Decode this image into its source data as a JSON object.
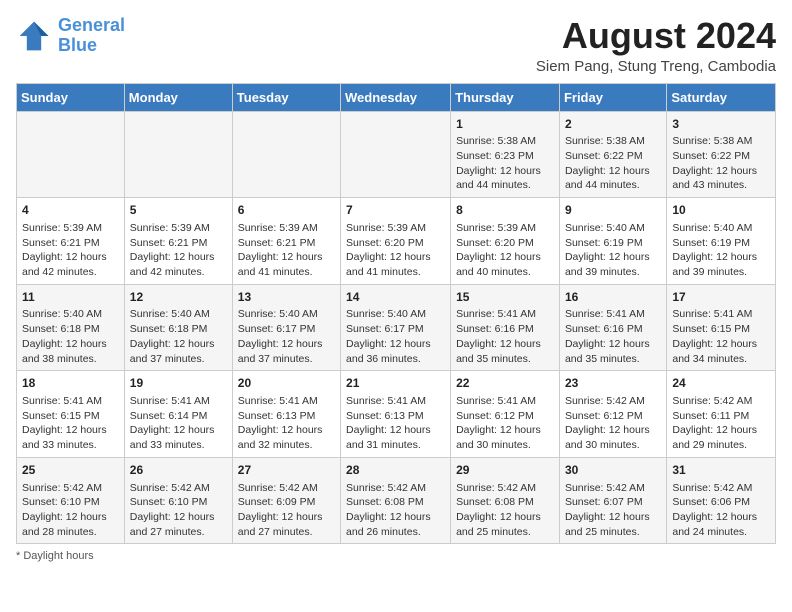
{
  "header": {
    "logo_line1": "General",
    "logo_line2": "Blue",
    "title": "August 2024",
    "subtitle": "Siem Pang, Stung Treng, Cambodia"
  },
  "days_of_week": [
    "Sunday",
    "Monday",
    "Tuesday",
    "Wednesday",
    "Thursday",
    "Friday",
    "Saturday"
  ],
  "weeks": [
    [
      {
        "day": "",
        "info": ""
      },
      {
        "day": "",
        "info": ""
      },
      {
        "day": "",
        "info": ""
      },
      {
        "day": "",
        "info": ""
      },
      {
        "day": "1",
        "info": "Sunrise: 5:38 AM\nSunset: 6:23 PM\nDaylight: 12 hours\nand 44 minutes."
      },
      {
        "day": "2",
        "info": "Sunrise: 5:38 AM\nSunset: 6:22 PM\nDaylight: 12 hours\nand 44 minutes."
      },
      {
        "day": "3",
        "info": "Sunrise: 5:38 AM\nSunset: 6:22 PM\nDaylight: 12 hours\nand 43 minutes."
      }
    ],
    [
      {
        "day": "4",
        "info": "Sunrise: 5:39 AM\nSunset: 6:21 PM\nDaylight: 12 hours\nand 42 minutes."
      },
      {
        "day": "5",
        "info": "Sunrise: 5:39 AM\nSunset: 6:21 PM\nDaylight: 12 hours\nand 42 minutes."
      },
      {
        "day": "6",
        "info": "Sunrise: 5:39 AM\nSunset: 6:21 PM\nDaylight: 12 hours\nand 41 minutes."
      },
      {
        "day": "7",
        "info": "Sunrise: 5:39 AM\nSunset: 6:20 PM\nDaylight: 12 hours\nand 41 minutes."
      },
      {
        "day": "8",
        "info": "Sunrise: 5:39 AM\nSunset: 6:20 PM\nDaylight: 12 hours\nand 40 minutes."
      },
      {
        "day": "9",
        "info": "Sunrise: 5:40 AM\nSunset: 6:19 PM\nDaylight: 12 hours\nand 39 minutes."
      },
      {
        "day": "10",
        "info": "Sunrise: 5:40 AM\nSunset: 6:19 PM\nDaylight: 12 hours\nand 39 minutes."
      }
    ],
    [
      {
        "day": "11",
        "info": "Sunrise: 5:40 AM\nSunset: 6:18 PM\nDaylight: 12 hours\nand 38 minutes."
      },
      {
        "day": "12",
        "info": "Sunrise: 5:40 AM\nSunset: 6:18 PM\nDaylight: 12 hours\nand 37 minutes."
      },
      {
        "day": "13",
        "info": "Sunrise: 5:40 AM\nSunset: 6:17 PM\nDaylight: 12 hours\nand 37 minutes."
      },
      {
        "day": "14",
        "info": "Sunrise: 5:40 AM\nSunset: 6:17 PM\nDaylight: 12 hours\nand 36 minutes."
      },
      {
        "day": "15",
        "info": "Sunrise: 5:41 AM\nSunset: 6:16 PM\nDaylight: 12 hours\nand 35 minutes."
      },
      {
        "day": "16",
        "info": "Sunrise: 5:41 AM\nSunset: 6:16 PM\nDaylight: 12 hours\nand 35 minutes."
      },
      {
        "day": "17",
        "info": "Sunrise: 5:41 AM\nSunset: 6:15 PM\nDaylight: 12 hours\nand 34 minutes."
      }
    ],
    [
      {
        "day": "18",
        "info": "Sunrise: 5:41 AM\nSunset: 6:15 PM\nDaylight: 12 hours\nand 33 minutes."
      },
      {
        "day": "19",
        "info": "Sunrise: 5:41 AM\nSunset: 6:14 PM\nDaylight: 12 hours\nand 33 minutes."
      },
      {
        "day": "20",
        "info": "Sunrise: 5:41 AM\nSunset: 6:13 PM\nDaylight: 12 hours\nand 32 minutes."
      },
      {
        "day": "21",
        "info": "Sunrise: 5:41 AM\nSunset: 6:13 PM\nDaylight: 12 hours\nand 31 minutes."
      },
      {
        "day": "22",
        "info": "Sunrise: 5:41 AM\nSunset: 6:12 PM\nDaylight: 12 hours\nand 30 minutes."
      },
      {
        "day": "23",
        "info": "Sunrise: 5:42 AM\nSunset: 6:12 PM\nDaylight: 12 hours\nand 30 minutes."
      },
      {
        "day": "24",
        "info": "Sunrise: 5:42 AM\nSunset: 6:11 PM\nDaylight: 12 hours\nand 29 minutes."
      }
    ],
    [
      {
        "day": "25",
        "info": "Sunrise: 5:42 AM\nSunset: 6:10 PM\nDaylight: 12 hours\nand 28 minutes."
      },
      {
        "day": "26",
        "info": "Sunrise: 5:42 AM\nSunset: 6:10 PM\nDaylight: 12 hours\nand 27 minutes."
      },
      {
        "day": "27",
        "info": "Sunrise: 5:42 AM\nSunset: 6:09 PM\nDaylight: 12 hours\nand 27 minutes."
      },
      {
        "day": "28",
        "info": "Sunrise: 5:42 AM\nSunset: 6:08 PM\nDaylight: 12 hours\nand 26 minutes."
      },
      {
        "day": "29",
        "info": "Sunrise: 5:42 AM\nSunset: 6:08 PM\nDaylight: 12 hours\nand 25 minutes."
      },
      {
        "day": "30",
        "info": "Sunrise: 5:42 AM\nSunset: 6:07 PM\nDaylight: 12 hours\nand 25 minutes."
      },
      {
        "day": "31",
        "info": "Sunrise: 5:42 AM\nSunset: 6:06 PM\nDaylight: 12 hours\nand 24 minutes."
      }
    ]
  ],
  "footer": {
    "note": "Daylight hours"
  }
}
